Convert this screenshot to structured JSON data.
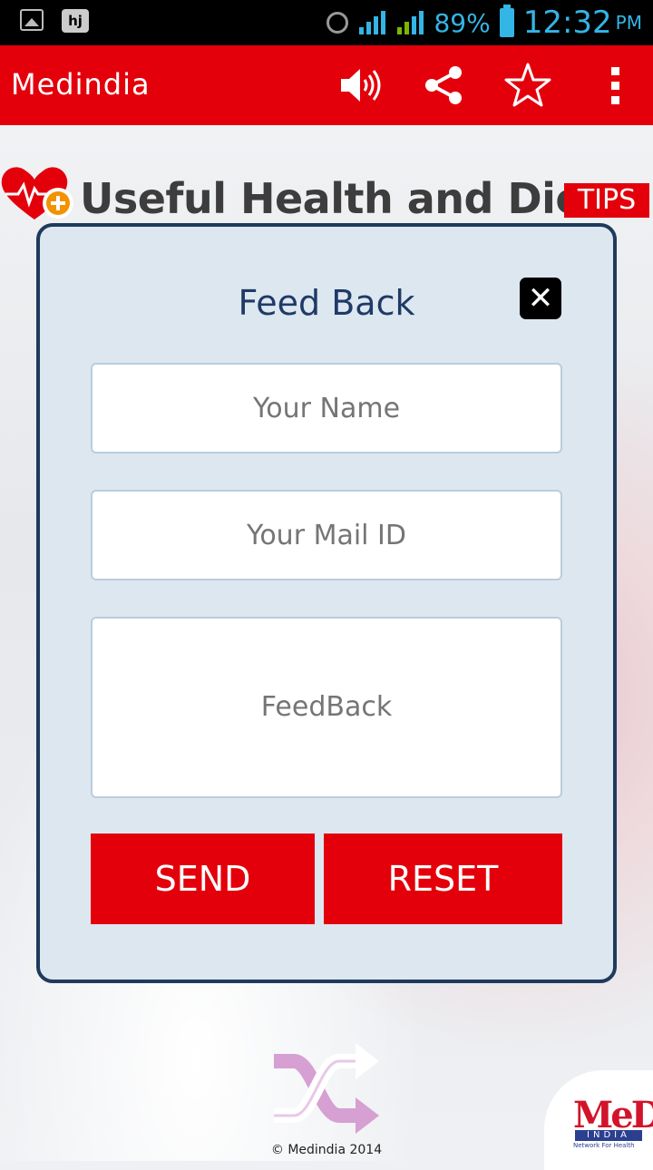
{
  "status_bar": {
    "battery_percent": "89%",
    "time": "12:32",
    "ampm": "PM",
    "icons": [
      "gallery-icon",
      "hj-icon",
      "alarm-icon",
      "signal-icon",
      "signal-icon",
      "battery-icon"
    ],
    "hj_label": "hj"
  },
  "action_bar": {
    "title": "Medindia",
    "actions": [
      "speaker-icon",
      "share-icon",
      "star-icon",
      "overflow-menu-icon"
    ],
    "color": "#e3000b"
  },
  "banner": {
    "title": "Useful Health and Diet",
    "badge": "TIPS"
  },
  "dialog": {
    "title": "Feed Back",
    "close_icon": "close-icon",
    "name_placeholder": "Your Name",
    "mail_placeholder": "Your Mail ID",
    "feedback_placeholder": "FeedBack",
    "send_label": "SEND",
    "reset_label": "RESET"
  },
  "footer": {
    "copyright": "© Medindia 2014",
    "shuffle_icon": "shuffle-icon",
    "logo_text": "MeD",
    "logo_india": "INDIA",
    "logo_tagline": "Network For Health"
  }
}
